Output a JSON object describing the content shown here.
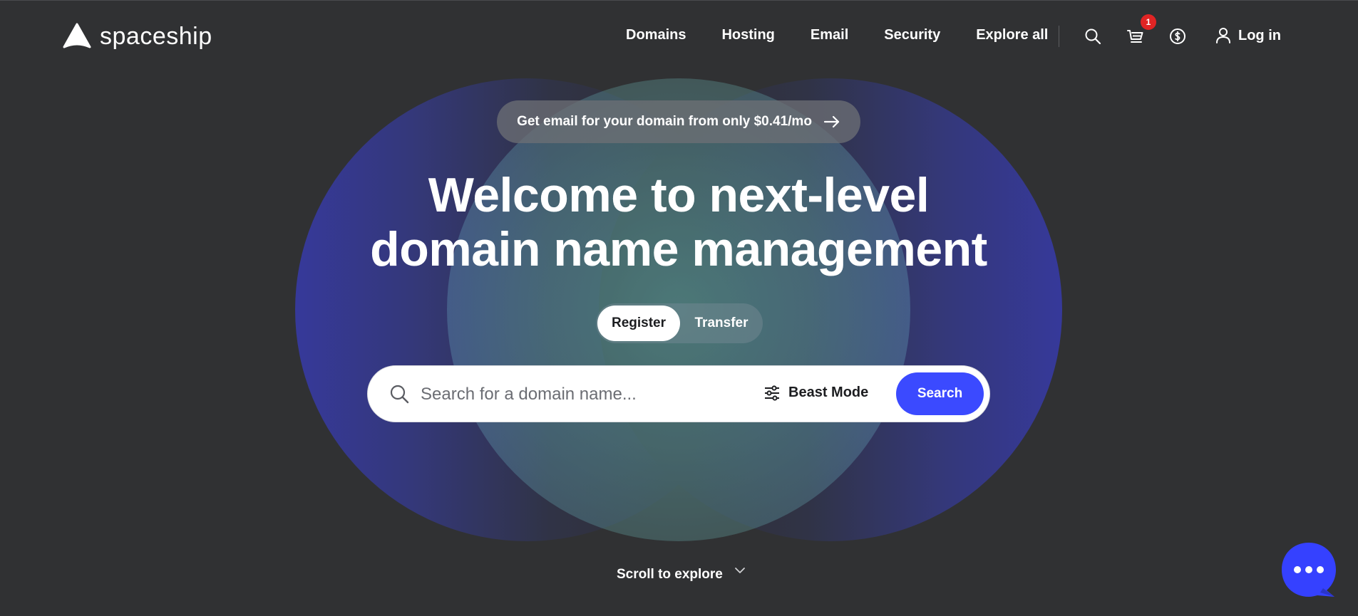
{
  "brand": {
    "name": "spaceship"
  },
  "nav": {
    "items": [
      {
        "label": "Domains"
      },
      {
        "label": "Hosting"
      },
      {
        "label": "Email"
      },
      {
        "label": "Security"
      },
      {
        "label": "Explore all"
      }
    ],
    "icons": [
      "search-icon",
      "cart-icon",
      "currency-icon",
      "user-icon"
    ],
    "cart_count": "1",
    "login_label": "Log in"
  },
  "promo": {
    "text": "Get email for your domain from only $0.41/mo"
  },
  "hero": {
    "title_line1": "Welcome to next-level",
    "title_line2": "domain name management"
  },
  "toggle": {
    "options": [
      "Register",
      "Transfer"
    ],
    "selected": "Register"
  },
  "search": {
    "placeholder": "Search for a domain name...",
    "value": "",
    "beast_mode_label": "Beast Mode",
    "button_label": "Search"
  },
  "scroll": {
    "label": "Scroll to explore"
  },
  "colors": {
    "background": "#303133",
    "accent": "#3b4aff",
    "badge": "#e02424",
    "circle_blue": "#36399a",
    "circle_teal": "#40a096"
  }
}
